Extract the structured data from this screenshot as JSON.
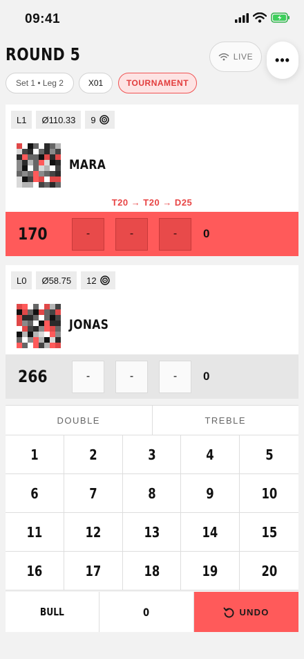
{
  "status_bar": {
    "time": "09:41",
    "icons": [
      "signal-icon",
      "wifi-icon",
      "battery-charging-icon"
    ]
  },
  "header": {
    "title": "ROUND 5",
    "live_label": "LIVE",
    "more_label": "•••",
    "pills": {
      "set_leg": "Set 1 • Leg 2",
      "mode": "X01",
      "tournament": "TOURNAMENT"
    }
  },
  "players": [
    {
      "legs": "L1",
      "average": "Ø110.33",
      "darts": "9",
      "name": "MARA",
      "checkout_hint": "T20 → T20 → D25",
      "remaining": "170",
      "darts_thrown": [
        "-",
        "-",
        "-"
      ],
      "turn_total": "0",
      "active": true
    },
    {
      "legs": "L0",
      "average": "Ø58.75",
      "darts": "12",
      "name": "JONAS",
      "remaining": "266",
      "darts_thrown": [
        "-",
        "-",
        "-"
      ],
      "turn_total": "0",
      "active": false
    }
  ],
  "keypad": {
    "modifiers": [
      "DOUBLE",
      "TREBLE"
    ],
    "numbers": [
      "1",
      "2",
      "3",
      "4",
      "5",
      "6",
      "7",
      "8",
      "9",
      "10",
      "11",
      "12",
      "13",
      "14",
      "15",
      "16",
      "17",
      "18",
      "19",
      "20"
    ],
    "bull": "BULL",
    "zero": "0",
    "undo": "UNDO"
  },
  "colors": {
    "accent": "#ff5a5a",
    "accent_text": "#e84545",
    "background": "#f2f2f2",
    "idle_row": "#e6e6e6"
  }
}
